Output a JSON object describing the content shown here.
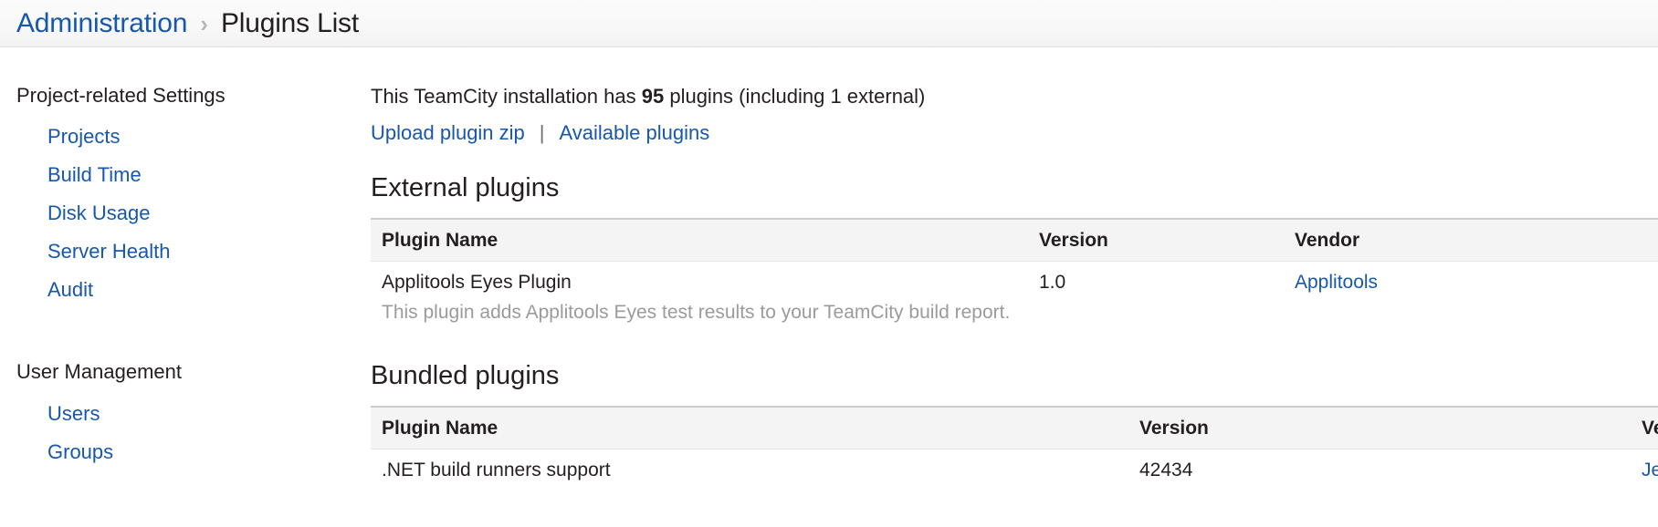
{
  "breadcrumb": {
    "root_label": "Administration",
    "separator": "›",
    "current_label": "Plugins List"
  },
  "sidebar": {
    "groups": [
      {
        "title": "Project-related Settings",
        "items": [
          {
            "label": "Projects"
          },
          {
            "label": "Build Time"
          },
          {
            "label": "Disk Usage"
          },
          {
            "label": "Server Health"
          },
          {
            "label": "Audit"
          }
        ]
      },
      {
        "title": "User Management",
        "items": [
          {
            "label": "Users"
          },
          {
            "label": "Groups"
          }
        ]
      }
    ]
  },
  "main": {
    "summary": {
      "prefix": "This TeamCity installation has ",
      "count": "95",
      "suffix": " plugins (including 1 external)"
    },
    "actions": {
      "upload_label": "Upload plugin zip",
      "divider": "|",
      "available_label": "Available plugins"
    },
    "external_section": {
      "title": "External plugins",
      "columns": [
        "Plugin Name",
        "Version",
        "Vendor"
      ],
      "rows": [
        {
          "name": "Applitools Eyes Plugin",
          "description": "This plugin adds Applitools Eyes test results to your TeamCity build report.",
          "version": "1.0",
          "vendor": "Applitools"
        }
      ]
    },
    "bundled_section": {
      "title": "Bundled plugins",
      "columns": [
        "Plugin Name",
        "Version",
        "Ve"
      ],
      "rows": [
        {
          "name": ".NET build runners support",
          "version": "42434",
          "vendor": "Je"
        }
      ]
    }
  },
  "colors": {
    "link": "#1758ad",
    "text": "#231f20",
    "muted": "#9b9b9b",
    "table_header_bg": "#f4f4f4",
    "rule": "#cccccc"
  }
}
